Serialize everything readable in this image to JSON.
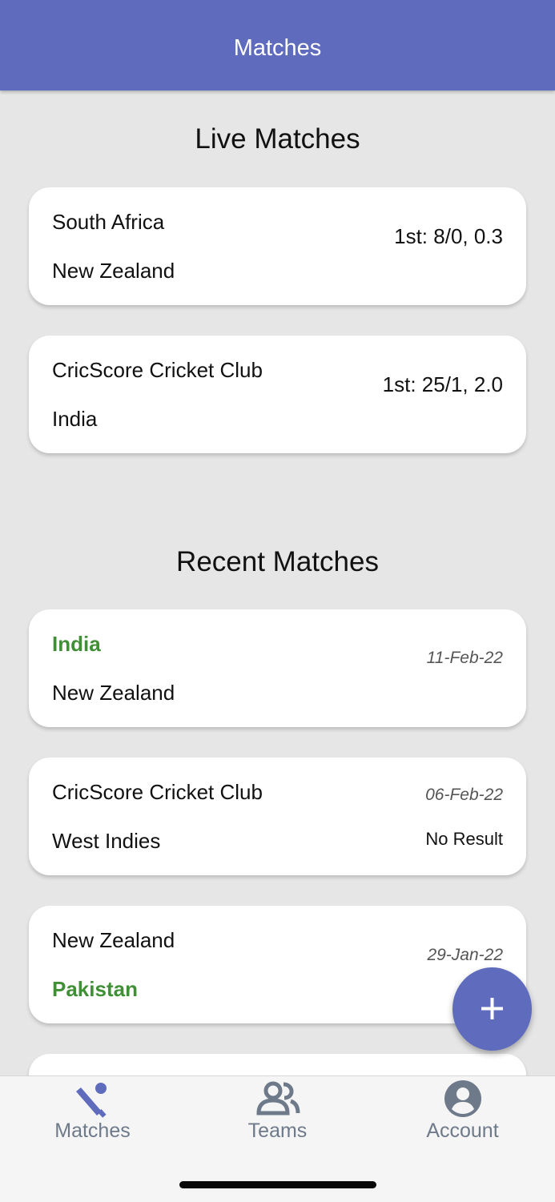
{
  "app_bar": {
    "title": "Matches"
  },
  "live": {
    "heading": "Live Matches",
    "matches": [
      {
        "team1": "South Africa",
        "team2": "New Zealand",
        "score": "1st: 8/0, 0.3"
      },
      {
        "team1": "CricScore Cricket Club",
        "team2": "India",
        "score": "1st: 25/1, 2.0"
      }
    ]
  },
  "recent": {
    "heading": "Recent Matches",
    "matches": [
      {
        "team1": "India",
        "team2": "New Zealand",
        "date": "11-Feb-22",
        "result": "",
        "winner": "team1"
      },
      {
        "team1": "CricScore Cricket Club",
        "team2": "West Indies",
        "date": "06-Feb-22",
        "result": "No Result",
        "winner": ""
      },
      {
        "team1": "New Zealand",
        "team2": "Pakistan",
        "date": "29-Jan-22",
        "result": "",
        "winner": "team2"
      }
    ]
  },
  "fab": {
    "icon": "plus-icon"
  },
  "nav": {
    "items": [
      {
        "label": "Matches",
        "icon": "cricket-bat-ball-icon",
        "active": true
      },
      {
        "label": "Teams",
        "icon": "people-icon",
        "active": false
      },
      {
        "label": "Account",
        "icon": "account-circle-icon",
        "active": false
      }
    ]
  },
  "colors": {
    "primary": "#5f6bbd",
    "winner": "#3f8f35",
    "background": "#e6e6e6",
    "nav_label": "#6e7a8a"
  }
}
